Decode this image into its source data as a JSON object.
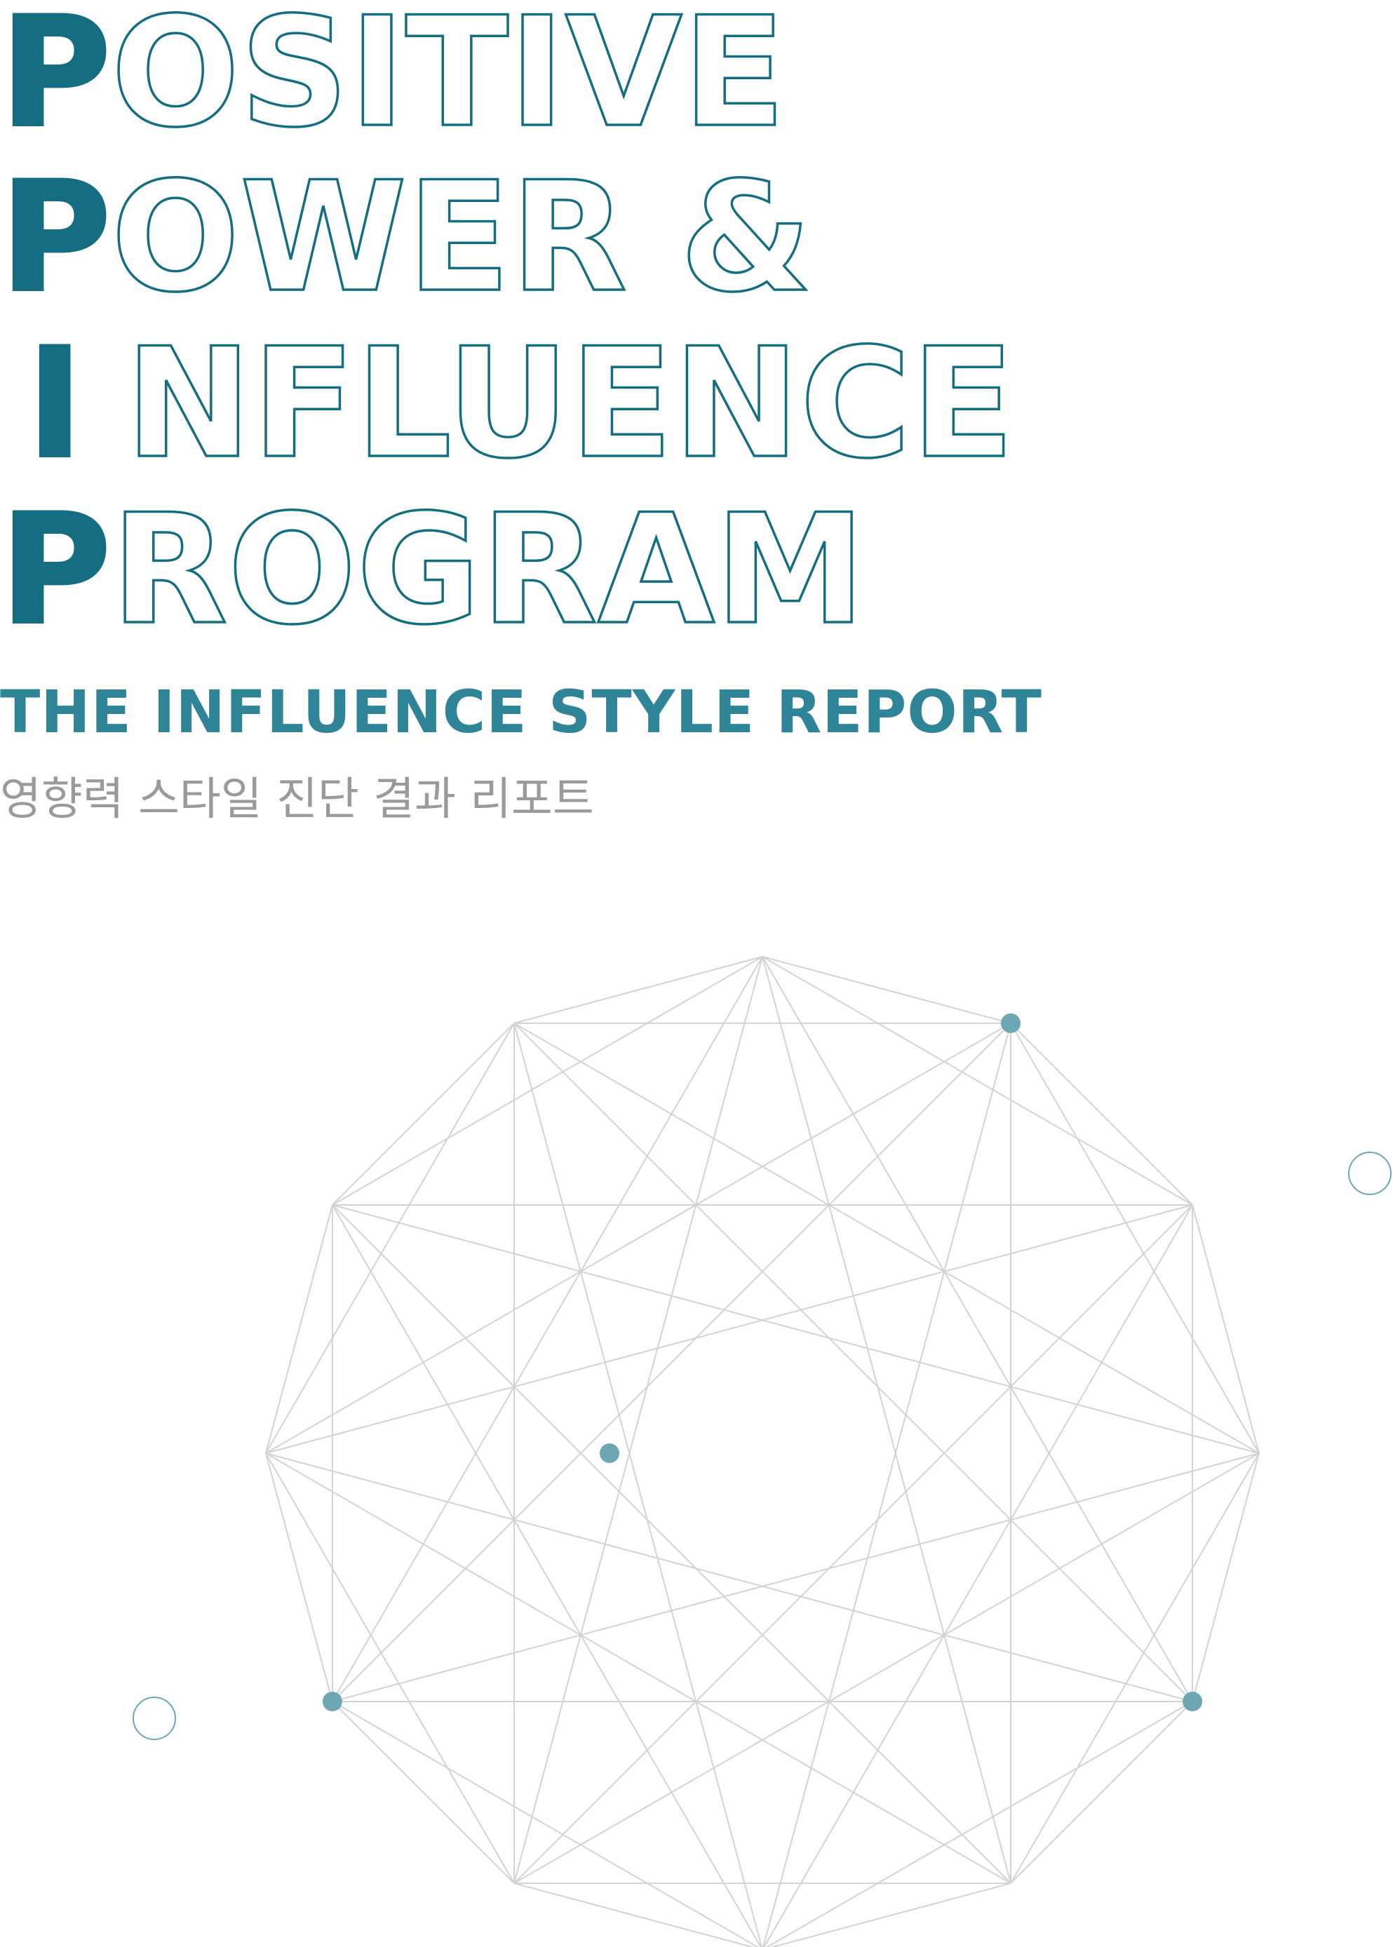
{
  "title": {
    "lines": [
      {
        "initial": "P",
        "rest": "OSITIVE"
      },
      {
        "initial": "P",
        "rest": "OWER &"
      },
      {
        "initial": "I",
        "rest": "NFLUENCE"
      },
      {
        "initial": "P",
        "rest": "ROGRAM"
      }
    ]
  },
  "subtitle": "THE INFLUENCE STYLE REPORT",
  "subtitle_korean": "영향력 스타일 진단 결과 리포트",
  "colors": {
    "primary": "#146d80",
    "accent": "#2f8497",
    "dot": "#6ea7b4",
    "line": "#d3d3d3",
    "korean_text": "#9a9a9a"
  },
  "graphic": {
    "type": "dodecagon-star-network",
    "vertex_count": 12,
    "highlighted_vertices": [
      0,
      3,
      7
    ],
    "center_dot": true,
    "outline_circle_count": 2
  }
}
